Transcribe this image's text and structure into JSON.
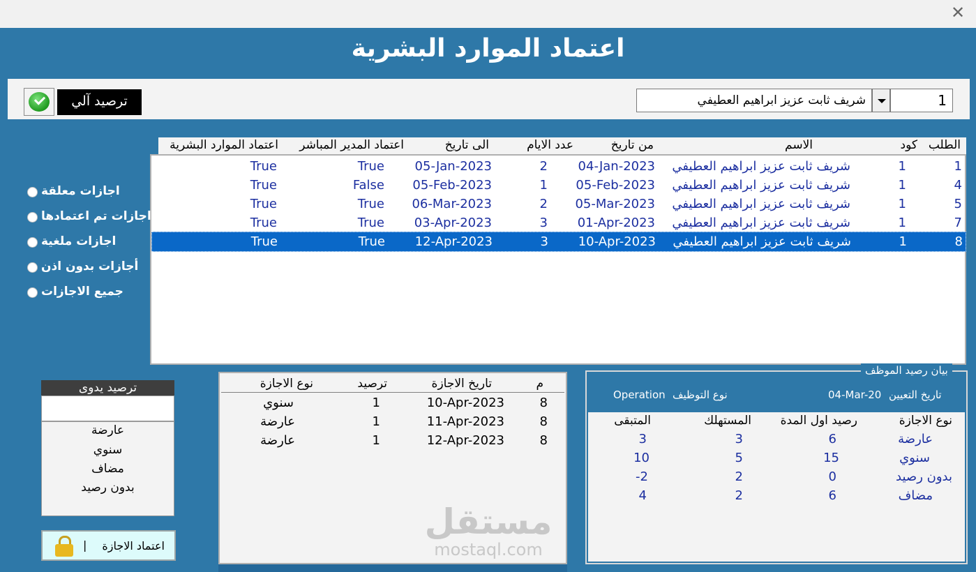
{
  "window": {
    "close_icon": "close-icon"
  },
  "title": "اعتماد الموارد البشرية",
  "selector": {
    "employee_name": "شريف ثابت عزيز ابراهيم العطيفي",
    "request_number": "1"
  },
  "auto_post_label": "ترصيد آلي",
  "requests_table": {
    "headers": {
      "request": "الطلب",
      "code": "كود",
      "name": "الاسم",
      "from_date": "من تاريخ",
      "days": "عدد الايام",
      "to_date": "الى تاريخ",
      "manager_approval": "اعتماد المدير المباشر",
      "hr_approval": "اعتماد الموارد البشرية"
    },
    "rows": [
      {
        "request": "1",
        "code": "1",
        "name": "شريف ثابت عزيز ابراهيم العطيفي",
        "from_date": "04-Jan-2023",
        "days": "2",
        "to_date": "05-Jan-2023",
        "manager_approval": "True",
        "hr_approval": "True"
      },
      {
        "request": "4",
        "code": "1",
        "name": "شريف ثابت عزيز ابراهيم العطيفي",
        "from_date": "05-Feb-2023",
        "days": "1",
        "to_date": "05-Feb-2023",
        "manager_approval": "False",
        "hr_approval": "True"
      },
      {
        "request": "5",
        "code": "1",
        "name": "شريف ثابت عزيز ابراهيم العطيفي",
        "from_date": "05-Mar-2023",
        "days": "2",
        "to_date": "06-Mar-2023",
        "manager_approval": "True",
        "hr_approval": "True"
      },
      {
        "request": "7",
        "code": "1",
        "name": "شريف ثابت عزيز ابراهيم العطيفي",
        "from_date": "01-Apr-2023",
        "days": "3",
        "to_date": "03-Apr-2023",
        "manager_approval": "True",
        "hr_approval": "True"
      },
      {
        "request": "8",
        "code": "1",
        "name": "شريف ثابت عزيز ابراهيم العطيفي",
        "from_date": "10-Apr-2023",
        "days": "3",
        "to_date": "12-Apr-2023",
        "manager_approval": "True",
        "hr_approval": "True"
      }
    ]
  },
  "filters": [
    "اجازات معلقة",
    "اجازات تم اعتمادها",
    "اجازات ملغية",
    "أجازات بدون اذن",
    "جميع الاجازات"
  ],
  "manual_post": {
    "title": "ترصيد يدوى",
    "input_value": "",
    "options": [
      "عارضة",
      "سنوي",
      "مضاف",
      "بدون رصيد"
    ]
  },
  "approve_button": {
    "label": "اعتماد الاجازة",
    "separator": "|",
    "icon": "lock-icon"
  },
  "days_table": {
    "headers": {
      "m": "م",
      "date": "تاريخ الاجازة",
      "posting": "ترصيد",
      "type": "نوع الاجازة"
    },
    "rows": [
      {
        "m": "8",
        "date": "10-Apr-2023",
        "posting": "1",
        "type": "سنوي"
      },
      {
        "m": "8",
        "date": "11-Apr-2023",
        "posting": "1",
        "type": "عارضة"
      },
      {
        "m": "8",
        "date": "12-Apr-2023",
        "posting": "1",
        "type": "عارضة"
      }
    ]
  },
  "balance": {
    "legend": "بيان رصيد الموظف",
    "hire_date_label": "تاريخ التعيين",
    "hire_date": "04-Mar-20",
    "employment_type_label": "نوع التوظيف",
    "employment_type": "Operation",
    "headers": {
      "type": "نوع الاجازة",
      "opening": "رصيد اول المدة",
      "used": "المستهلك",
      "remaining": "المتبقى"
    },
    "rows": [
      {
        "type": "عارضة",
        "opening": "6",
        "used": "3",
        "remaining": "3"
      },
      {
        "type": "سنوي",
        "opening": "15",
        "used": "5",
        "remaining": "10"
      },
      {
        "type": "بدون رصيد",
        "opening": "0",
        "used": "2",
        "remaining": "-2"
      },
      {
        "type": "مضاف",
        "opening": "6",
        "used": "2",
        "remaining": "4"
      }
    ]
  },
  "watermark": {
    "arabic": "مستقل",
    "latin": "mostaql.com"
  }
}
